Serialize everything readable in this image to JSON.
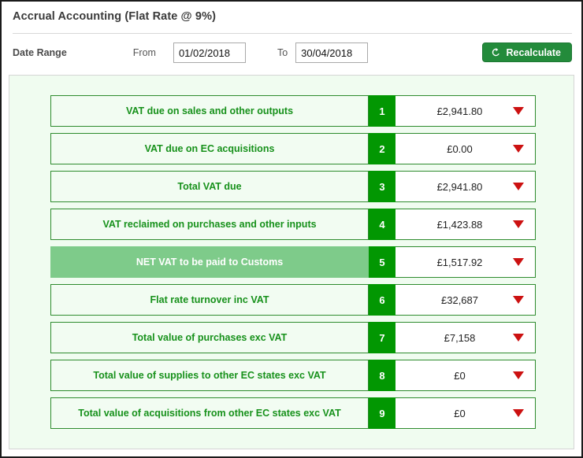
{
  "header": {
    "title": "Accrual Accounting (Flat Rate @ 9%)"
  },
  "filters": {
    "date_range_label": "Date Range",
    "from_label": "From",
    "from_value": "01/02/2018",
    "to_label": "To",
    "to_value": "30/04/2018",
    "recalculate_label": "Recalculate",
    "recalculate_icon": "refresh-icon"
  },
  "colors": {
    "accent_green": "#029702",
    "button_green": "#238b3b",
    "label_text_green": "#17911b",
    "highlight_green": "#7ecb8a",
    "caret_red": "#cc1111",
    "panel_background": "#f0fcf0"
  },
  "vat_rows": [
    {
      "num": "1",
      "label": "VAT due on sales and other outputs",
      "value": "£2,941.80",
      "highlight": false
    },
    {
      "num": "2",
      "label": "VAT due on EC acquisitions",
      "value": "£0.00",
      "highlight": false
    },
    {
      "num": "3",
      "label": "Total VAT due",
      "value": "£2,941.80",
      "highlight": false
    },
    {
      "num": "4",
      "label": "VAT reclaimed on purchases and other inputs",
      "value": "£1,423.88",
      "highlight": false
    },
    {
      "num": "5",
      "label": "NET VAT to be paid to Customs",
      "value": "£1,517.92",
      "highlight": true
    },
    {
      "num": "6",
      "label": "Flat rate turnover inc VAT",
      "value": "£32,687",
      "highlight": false
    },
    {
      "num": "7",
      "label": "Total value of purchases exc VAT",
      "value": "£7,158",
      "highlight": false
    },
    {
      "num": "8",
      "label": "Total value of supplies to other EC states exc VAT",
      "value": "£0",
      "highlight": false
    },
    {
      "num": "9",
      "label": "Total value of acquisitions from other EC states exc VAT",
      "value": "£0",
      "highlight": false
    }
  ]
}
